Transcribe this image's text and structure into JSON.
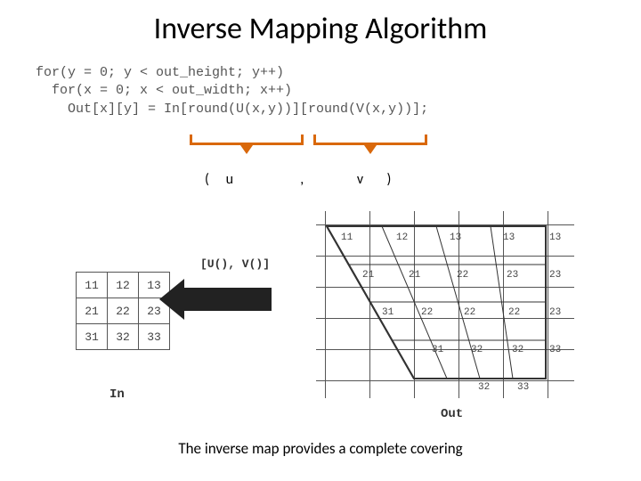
{
  "title": "Inverse Mapping Algorithm",
  "code": {
    "l1": "for(y = 0; y < out_height; y++)",
    "l2": "  for(x = 0; x < out_width; x++)",
    "l3": "    Out[x][y] = In[round(U(x,y))][round(V(x,y))];"
  },
  "uv": {
    "open": "(",
    "u": "u",
    "comma": ",",
    "v": "v",
    "close": ")"
  },
  "arrow_label": "[U(), V()]",
  "in_label": "In",
  "out_label": "Out",
  "in_grid": [
    [
      "11",
      "12",
      "13"
    ],
    [
      "21",
      "22",
      "23"
    ],
    [
      "31",
      "32",
      "33"
    ]
  ],
  "out_grid": [
    [
      "11",
      "12",
      "13",
      "13",
      "13"
    ],
    [
      "21",
      "21",
      "22",
      "23",
      "23"
    ],
    [
      "31",
      "22",
      "22",
      "22",
      "23"
    ],
    [
      "",
      "31",
      "32",
      "32",
      "33"
    ],
    [
      "",
      "",
      "32",
      "33",
      ""
    ]
  ],
  "footer": "The inverse map provides a complete covering"
}
